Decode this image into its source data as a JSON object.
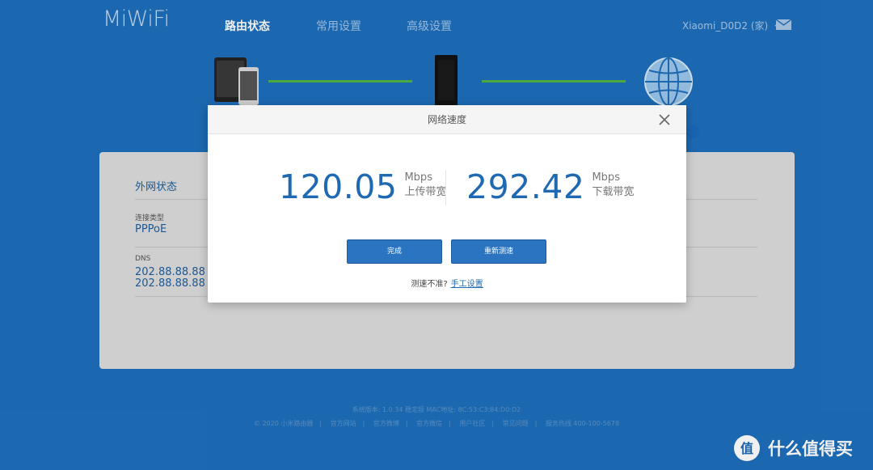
{
  "header": {
    "logo": "MiWiFi",
    "nav": [
      "路由状态",
      "常用设置",
      "高级设置"
    ],
    "router_name": "Xiaomi_D0D2 (家)"
  },
  "status_panel": {
    "title": "外网状态",
    "conn_type_label": "连接类型",
    "conn_type_value": "PPPoE",
    "dns_label": "DNS",
    "dns_values": [
      "202.88.88.88",
      "202.88.88.88"
    ]
  },
  "footer": {
    "line1": "系统版本: 1.0.34 稳定版  MAC地址: 8C:53:C3:84:D0:D2",
    "links": [
      "© 2020 小米路由器",
      "官方网站",
      "官方微博",
      "官方微信",
      "用户社区",
      "常见问题",
      "服务热线 400-100-5678"
    ]
  },
  "modal": {
    "title": "网络速度",
    "upload": {
      "value": "120.05",
      "unit": "Mbps",
      "label": "上传带宽"
    },
    "download": {
      "value": "292.42",
      "unit": "Mbps",
      "label": "下载带宽"
    },
    "done_button": "完成",
    "retest_button": "重新测速",
    "hint_text": "测速不准?",
    "hint_link": "手工设置"
  },
  "watermark": {
    "text": "什么值得买",
    "logo_char": "值"
  },
  "colors": {
    "background": "#1e6fbc",
    "accent": "#1f69b3",
    "link_line": "#52b347",
    "button": "#2b74c1"
  },
  "icons": [
    "mail-icon",
    "close-icon",
    "phone-tablet-icon",
    "router-icon",
    "globe-icon"
  ]
}
